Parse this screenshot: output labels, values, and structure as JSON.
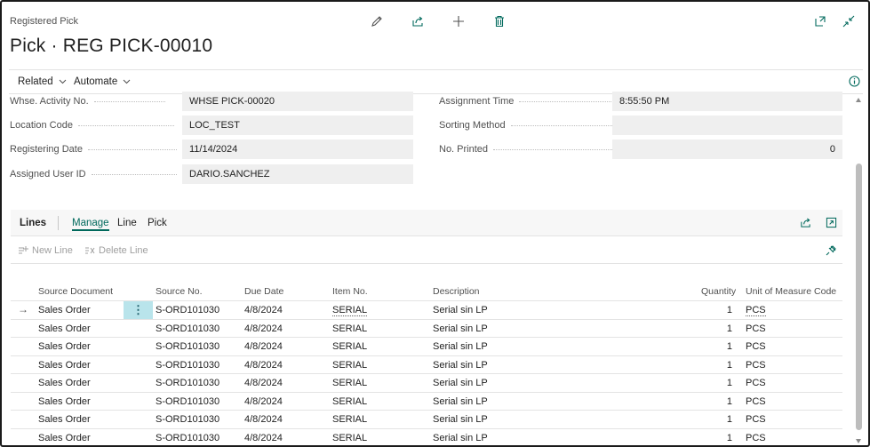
{
  "header": {
    "caption": "Registered Pick",
    "title": "Pick · REG PICK-00010",
    "icons": [
      "edit-icon",
      "share-icon",
      "new-icon",
      "delete-icon",
      "open-new-window-icon",
      "collapse-icon"
    ]
  },
  "actions": {
    "related": "Related",
    "automate": "Automate"
  },
  "fields": {
    "whse_activity_no": {
      "label": "Whse. Activity No.",
      "value": "WHSE PICK-00020"
    },
    "location_code": {
      "label": "Location Code",
      "value": "LOC_TEST"
    },
    "registering_date": {
      "label": "Registering Date",
      "value": "11/14/2024"
    },
    "assigned_user_id": {
      "label": "Assigned User ID",
      "value": "DARIO.SANCHEZ"
    },
    "assignment_time": {
      "label": "Assignment Time",
      "value": "8:55:50 PM"
    },
    "sorting_method": {
      "label": "Sorting Method",
      "value": ""
    },
    "no_printed": {
      "label": "No. Printed",
      "value": "0"
    }
  },
  "lines": {
    "title": "Lines",
    "tabs": [
      "Manage",
      "Line",
      "Pick"
    ],
    "tools": {
      "new_line": "New Line",
      "delete_line": "Delete Line"
    },
    "columns": [
      "Source Document",
      "Source No.",
      "Due Date",
      "Item No.",
      "Description",
      "Quantity",
      "Unit of Measure Code"
    ],
    "rows": [
      [
        "Sales Order",
        "S-ORD101030",
        "4/8/2024",
        "SERIAL",
        "Serial sin LP",
        "1",
        "PCS"
      ],
      [
        "Sales Order",
        "S-ORD101030",
        "4/8/2024",
        "SERIAL",
        "Serial sin LP",
        "1",
        "PCS"
      ],
      [
        "Sales Order",
        "S-ORD101030",
        "4/8/2024",
        "SERIAL",
        "Serial sin LP",
        "1",
        "PCS"
      ],
      [
        "Sales Order",
        "S-ORD101030",
        "4/8/2024",
        "SERIAL",
        "Serial sin LP",
        "1",
        "PCS"
      ],
      [
        "Sales Order",
        "S-ORD101030",
        "4/8/2024",
        "SERIAL",
        "Serial sin LP",
        "1",
        "PCS"
      ],
      [
        "Sales Order",
        "S-ORD101030",
        "4/8/2024",
        "SERIAL",
        "Serial sin LP",
        "1",
        "PCS"
      ],
      [
        "Sales Order",
        "S-ORD101030",
        "4/8/2024",
        "SERIAL",
        "Serial sin LP",
        "1",
        "PCS"
      ],
      [
        "Sales Order",
        "S-ORD101030",
        "4/8/2024",
        "SERIAL",
        "Serial sin LP",
        "1",
        "PCS"
      ]
    ]
  },
  "colors": {
    "accent": "#00695c",
    "selected_cell": "#b9e4eb",
    "field_bg": "#efefef"
  }
}
